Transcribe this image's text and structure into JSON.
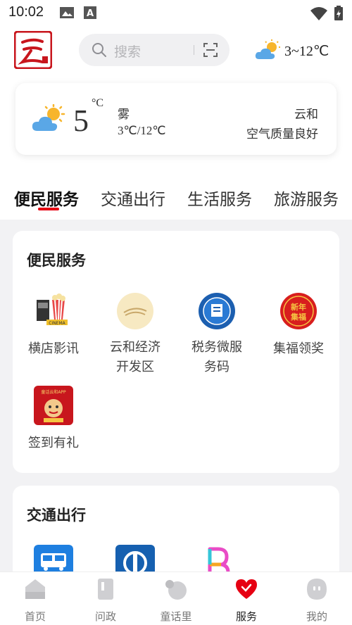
{
  "status_bar": {
    "time": "10:02"
  },
  "header": {
    "search_placeholder": "搜索",
    "weather_range": "3~12℃"
  },
  "weather_card": {
    "temperature": "5",
    "unit": "°C",
    "condition": "雾",
    "range": "3℃/12℃",
    "city": "云和",
    "air_quality": "空气质量良好"
  },
  "tabs": [
    {
      "label": "便民服务",
      "active": true
    },
    {
      "label": "交通出行",
      "active": false
    },
    {
      "label": "生活服务",
      "active": false
    },
    {
      "label": "旅游服务",
      "active": false
    }
  ],
  "sections": [
    {
      "title": "便民服务",
      "items": [
        {
          "label": "横店影讯",
          "icon": "cinema-icon"
        },
        {
          "label": "云和经济开发区",
          "icon": "development-zone-icon"
        },
        {
          "label": "税务微服务码",
          "icon": "tax-service-icon"
        },
        {
          "label": "集福领奖",
          "icon": "new-year-fortune-icon",
          "icon_text": "新年集福"
        },
        {
          "label": "签到有礼",
          "icon": "checkin-gift-icon",
          "icon_text": "童话云和APP"
        }
      ]
    },
    {
      "title": "交通出行",
      "items": [
        {
          "label": "",
          "icon": "bus-ticket-icon",
          "icon_text": "汽车票"
        },
        {
          "label": "",
          "icon": "railway-icon"
        },
        {
          "label": "",
          "icon": "bike-b-icon"
        }
      ]
    }
  ],
  "bottom_nav": [
    {
      "label": "首页",
      "icon": "home-icon",
      "active": false
    },
    {
      "label": "问政",
      "icon": "inquiry-icon",
      "active": false
    },
    {
      "label": "童话里",
      "icon": "fairytale-icon",
      "active": false
    },
    {
      "label": "服务",
      "icon": "heart-service-icon",
      "active": true
    },
    {
      "label": "我的",
      "icon": "profile-icon",
      "active": false
    }
  ],
  "colors": {
    "accent": "#e60012",
    "background": "#f2f2f4"
  }
}
